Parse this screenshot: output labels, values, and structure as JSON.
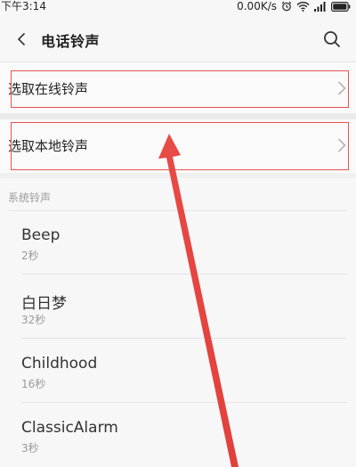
{
  "status_bar": {
    "time": "下午3:14",
    "network_speed": "0.00K/s",
    "icons": [
      "alarm-icon",
      "wifi-icon",
      "signal-icon",
      "battery-icon"
    ]
  },
  "header": {
    "title": "电话铃声",
    "back_icon": "chevron-left-icon",
    "search_icon": "search-icon"
  },
  "menu": {
    "online_label": "选取在线铃声",
    "local_label": "选取本地铃声"
  },
  "section": {
    "system_label": "系统铃声"
  },
  "ringtones": [
    {
      "name": "Beep",
      "duration": "2秒"
    },
    {
      "name": "白日梦",
      "duration": "32秒"
    },
    {
      "name": "Childhood",
      "duration": "16秒"
    },
    {
      "name": "ClassicAlarm",
      "duration": "3秒"
    }
  ],
  "colors": {
    "annotation_red": "#e8534f",
    "background": "#f7f7f7"
  }
}
